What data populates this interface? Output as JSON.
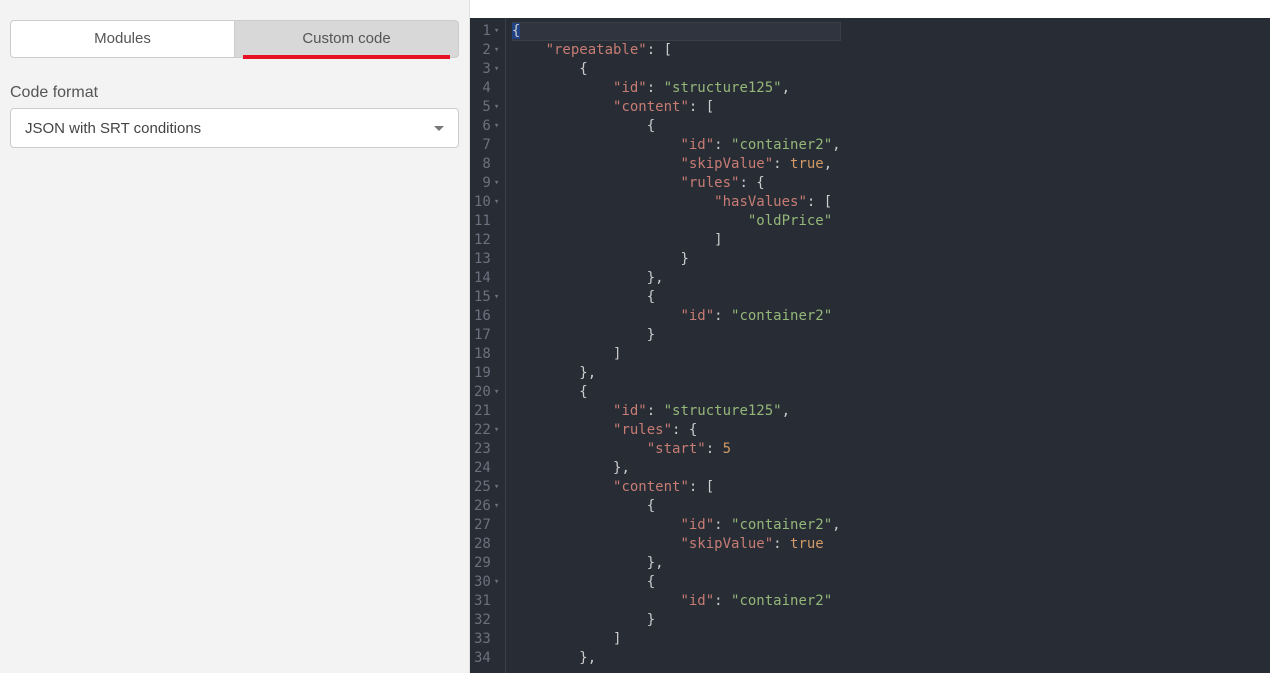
{
  "sidebar": {
    "tabs": {
      "modules": "Modules",
      "custom": "Custom code"
    },
    "active_tab": "custom",
    "code_format_label": "Code format",
    "code_format_value": "JSON with SRT conditions"
  },
  "editor": {
    "lines": [
      {
        "n": 1,
        "fold": true,
        "html": "<span class='sel p'>{</span>"
      },
      {
        "n": 2,
        "fold": true,
        "html": "    <span class='k'>\"repeatable\"</span><span class='p'>: [</span>"
      },
      {
        "n": 3,
        "fold": true,
        "html": "        <span class='p'>{</span>"
      },
      {
        "n": 4,
        "fold": false,
        "html": "            <span class='k'>\"id\"</span><span class='p'>: </span><span class='s'>\"structure125\"</span><span class='p'>,</span>"
      },
      {
        "n": 5,
        "fold": true,
        "html": "            <span class='k'>\"content\"</span><span class='p'>: [</span>"
      },
      {
        "n": 6,
        "fold": true,
        "html": "                <span class='p'>{</span>"
      },
      {
        "n": 7,
        "fold": false,
        "html": "                    <span class='k'>\"id\"</span><span class='p'>: </span><span class='s'>\"container2\"</span><span class='p'>,</span>"
      },
      {
        "n": 8,
        "fold": false,
        "html": "                    <span class='k'>\"skipValue\"</span><span class='p'>: </span><span class='b'>true</span><span class='p'>,</span>"
      },
      {
        "n": 9,
        "fold": true,
        "html": "                    <span class='k'>\"rules\"</span><span class='p'>: {</span>"
      },
      {
        "n": 10,
        "fold": true,
        "html": "                        <span class='k'>\"hasValues\"</span><span class='p'>: [</span>"
      },
      {
        "n": 11,
        "fold": false,
        "html": "                            <span class='s'>\"oldPrice\"</span>"
      },
      {
        "n": 12,
        "fold": false,
        "html": "                        <span class='p'>]</span>"
      },
      {
        "n": 13,
        "fold": false,
        "html": "                    <span class='p'>}</span>"
      },
      {
        "n": 14,
        "fold": false,
        "html": "                <span class='p'>},</span>"
      },
      {
        "n": 15,
        "fold": true,
        "html": "                <span class='p'>{</span>"
      },
      {
        "n": 16,
        "fold": false,
        "html": "                    <span class='k'>\"id\"</span><span class='p'>: </span><span class='s'>\"container2\"</span>"
      },
      {
        "n": 17,
        "fold": false,
        "html": "                <span class='p'>}</span>"
      },
      {
        "n": 18,
        "fold": false,
        "html": "            <span class='p'>]</span>"
      },
      {
        "n": 19,
        "fold": false,
        "html": "        <span class='p'>},</span>"
      },
      {
        "n": 20,
        "fold": true,
        "html": "        <span class='p'>{</span>"
      },
      {
        "n": 21,
        "fold": false,
        "html": "            <span class='k'>\"id\"</span><span class='p'>: </span><span class='s'>\"structure125\"</span><span class='p'>,</span>"
      },
      {
        "n": 22,
        "fold": true,
        "html": "            <span class='k'>\"rules\"</span><span class='p'>: {</span>"
      },
      {
        "n": 23,
        "fold": false,
        "html": "                <span class='k'>\"start\"</span><span class='p'>: </span><span class='n'>5</span>"
      },
      {
        "n": 24,
        "fold": false,
        "html": "            <span class='p'>},</span>"
      },
      {
        "n": 25,
        "fold": true,
        "html": "            <span class='k'>\"content\"</span><span class='p'>: [</span>"
      },
      {
        "n": 26,
        "fold": true,
        "html": "                <span class='p'>{</span>"
      },
      {
        "n": 27,
        "fold": false,
        "html": "                    <span class='k'>\"id\"</span><span class='p'>: </span><span class='s'>\"container2\"</span><span class='p'>,</span>"
      },
      {
        "n": 28,
        "fold": false,
        "html": "                    <span class='k'>\"skipValue\"</span><span class='p'>: </span><span class='b'>true</span>"
      },
      {
        "n": 29,
        "fold": false,
        "html": "                <span class='p'>},</span>"
      },
      {
        "n": 30,
        "fold": true,
        "html": "                <span class='p'>{</span>"
      },
      {
        "n": 31,
        "fold": false,
        "html": "                    <span class='k'>\"id\"</span><span class='p'>: </span><span class='s'>\"container2\"</span>"
      },
      {
        "n": 32,
        "fold": false,
        "html": "                <span class='p'>}</span>"
      },
      {
        "n": 33,
        "fold": false,
        "html": "            <span class='p'>]</span>"
      },
      {
        "n": 34,
        "fold": false,
        "html": "        <span class='p'>},</span>"
      }
    ]
  }
}
